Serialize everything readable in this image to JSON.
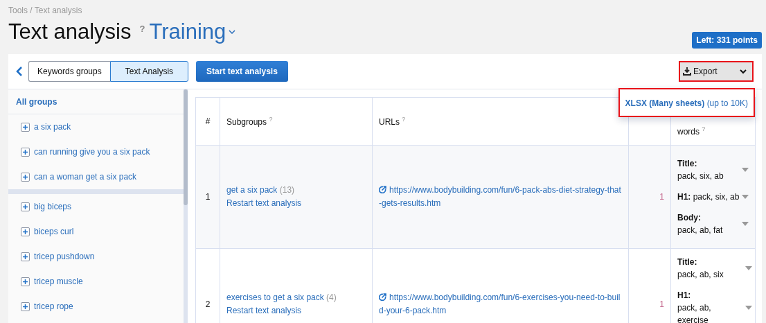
{
  "breadcrumb": "Tools / Text analysis",
  "title": "Text analysis",
  "title_help": "?",
  "project": "Training",
  "points_badge": "Left: 331 points",
  "tabs": [
    {
      "label": "Keywords groups",
      "selected": false
    },
    {
      "label": "Text Analysis",
      "selected": true
    }
  ],
  "start_button": "Start text analysis",
  "export": {
    "label": "Export",
    "expanded": true,
    "menu": [
      {
        "label": "XLSX (Many sheets)",
        "note": "(up to 10K)"
      }
    ]
  },
  "sidebar": {
    "header": "All groups",
    "groups": [
      {
        "items": [
          "a six pack",
          "can running give you a six pack",
          "can a woman get a six pack"
        ]
      },
      {
        "items": [
          "big biceps",
          "biceps curl",
          "tricep pushdown",
          "tricep muscle",
          "tricep rope"
        ]
      }
    ]
  },
  "table": {
    "columns": [
      {
        "label": "#"
      },
      {
        "label": "Subgroups",
        "help": "?"
      },
      {
        "label": "URLs",
        "help": "?"
      },
      {},
      {
        "label": "words",
        "help": "?"
      }
    ],
    "rows": [
      {
        "number": "1",
        "subgroup": "get a six pack",
        "count": "(13)",
        "action": "Restart text analysis",
        "url": "https://www.bodybuilding.com/fun/6-pack-abs-diet-strategy-that-gets-results.htm",
        "errors": "1",
        "keywords": [
          {
            "label": "Title:",
            "value": "pack, six, ab",
            "kind": "block"
          },
          {
            "label": "H1:",
            "value": "pack, six, ab",
            "kind": "inline"
          },
          {
            "label": "Body:",
            "value": "pack, ab, fat",
            "kind": "block"
          }
        ]
      },
      {
        "number": "2",
        "subgroup": "exercises to get a six pack",
        "count": "(4)",
        "action": "Restart text analysis",
        "url": "https://www.bodybuilding.com/fun/6-exercises-you-need-to-build-your-6-pack.htm",
        "errors": "1",
        "keywords": [
          {
            "label": "Title:",
            "value": "pack, ab, six",
            "kind": "block"
          },
          {
            "label": "H1:",
            "value": "pack, ab, exercise",
            "kind": "block"
          }
        ]
      }
    ]
  }
}
